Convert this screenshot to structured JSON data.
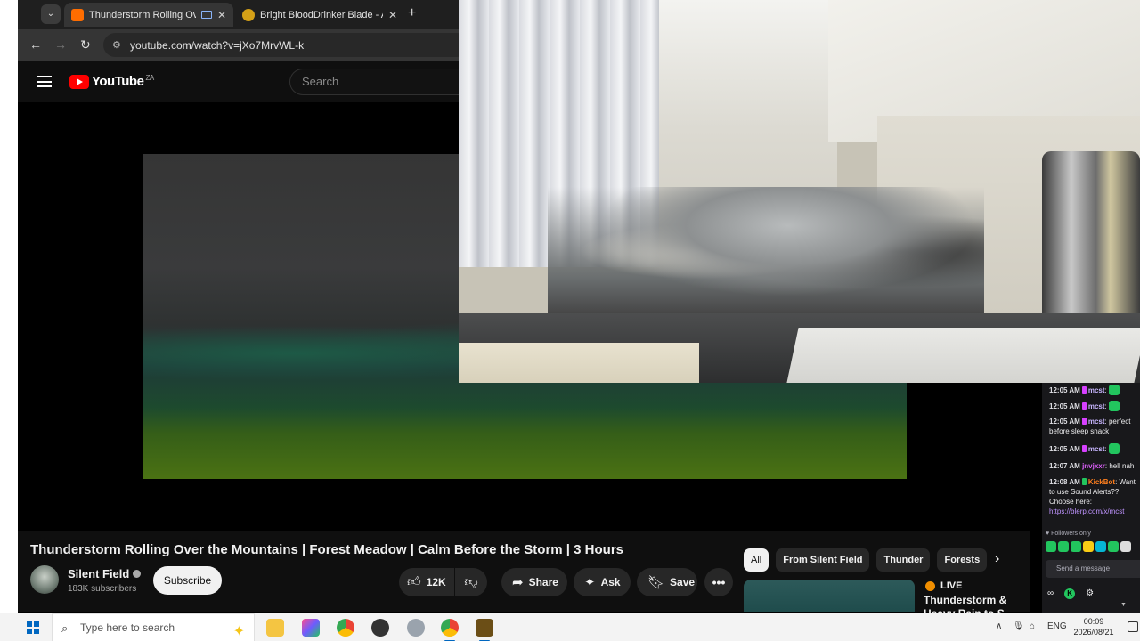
{
  "browser": {
    "tabs": [
      {
        "title": "Thunderstorm Rolling Over",
        "active": true,
        "favicon_color": "#ff6d00"
      },
      {
        "title": "Bright BloodDrinker Blade - AC",
        "active": false,
        "favicon_color": "#d4a017"
      }
    ],
    "url": "youtube.com/watch?v=jXo7MrvWL-k"
  },
  "youtube": {
    "logo_text": "YouTube",
    "region": "ZA",
    "search_placeholder": "Search",
    "video_title": "Thunderstorm Rolling Over the Mountains | Forest Meadow | Calm Before the Storm | 3 Hours",
    "channel": {
      "name": "Silent Field",
      "subscribers": "183K subscribers"
    },
    "subscribe_label": "Subscribe",
    "actions": {
      "likes": "12K",
      "share": "Share",
      "ask": "Ask",
      "save": "Save"
    },
    "chips": [
      "All",
      "From Silent Field",
      "Thunder",
      "Forests"
    ],
    "recommendation": {
      "live_label": "LIVE",
      "title": "Thunderstorm & Heavy Rain to S"
    }
  },
  "chat": {
    "messages": [
      {
        "time": "12:05 AM",
        "user": "mcst",
        "text": ""
      },
      {
        "time": "12:05 AM",
        "user": "mcst",
        "text": ""
      },
      {
        "time": "12:05 AM",
        "user": "mcst",
        "text": "perfect before sleep snack"
      },
      {
        "time": "12:05 AM",
        "user": "mcst",
        "text": ""
      },
      {
        "time": "12:07 AM",
        "user": "jnvjxxr",
        "text": "hell nah"
      },
      {
        "time": "12:08 AM",
        "user": "KickBot",
        "text": "Want to use Sound Alerts?? Choose here:",
        "link": "https://blerp.com/x/mcst"
      }
    ],
    "followers_only": "Followers only",
    "input_placeholder": "Send a message"
  },
  "taskbar": {
    "search_placeholder": "Type here to search",
    "language": "ENG",
    "time": "00:09",
    "date": "2026/08/21"
  },
  "colors": {
    "youtube_red": "#ff0000",
    "live_orange": "#f08e00",
    "kick_green": "#22c55e",
    "taskbar_accent": "#0067c0"
  }
}
